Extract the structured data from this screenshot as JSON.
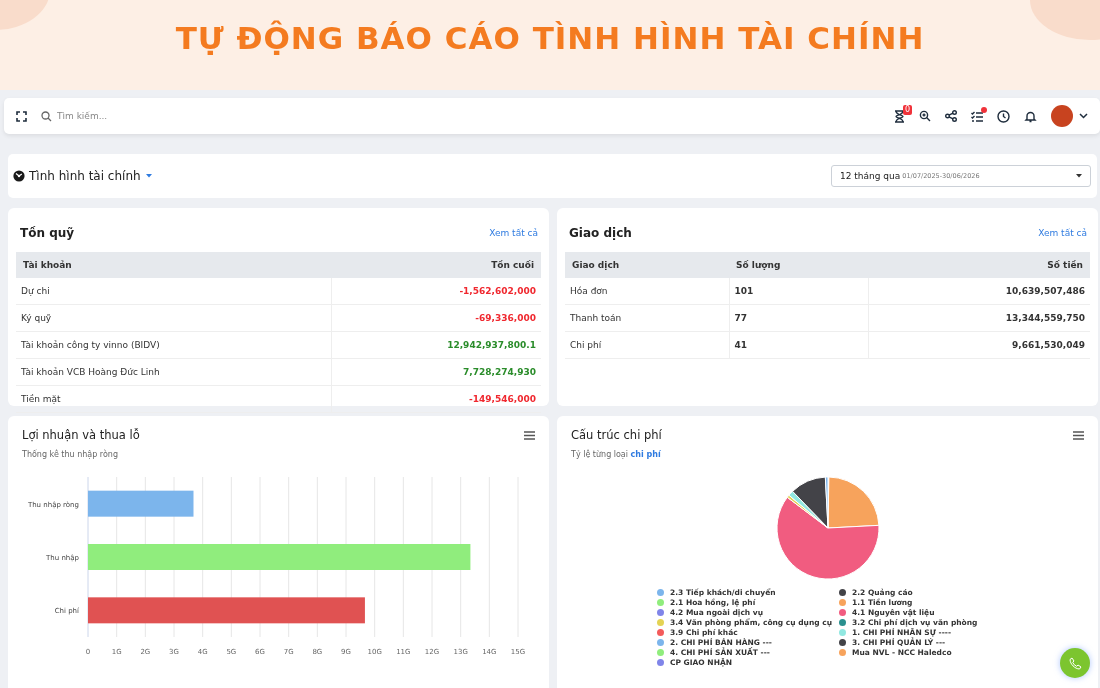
{
  "banner": {
    "title": "TỰ ĐỘNG BÁO CÁO TÌNH HÌNH TÀI CHÍNH"
  },
  "topbar": {
    "search_placeholder": "Tìm kiếm...",
    "hourglass_badge": "0",
    "tasks_dot": true
  },
  "filter": {
    "title": "Tình hình tài chính",
    "period": "12 tháng qua",
    "range": "01/07/2025-30/06/2026"
  },
  "fund_balance": {
    "title": "Tồn quỹ",
    "link": "Xem tất cả",
    "columns": [
      "Tài khoản",
      "Tồn cuối"
    ],
    "rows": [
      {
        "account": "Dự chi",
        "balance": "-1,562,602,000",
        "color": "#f0282f"
      },
      {
        "account": "Ký quỹ",
        "balance": "-69,336,000",
        "color": "#f0282f"
      },
      {
        "account": "Tài khoản công ty vinno (BIDV)",
        "balance": "12,942,937,800.1",
        "color": "#2a8c2a"
      },
      {
        "account": "Tài khoản VCB Hoàng Đức Linh",
        "balance": "7,728,274,930",
        "color": "#2a8c2a"
      },
      {
        "account": "Tiền mặt",
        "balance": "-149,546,000",
        "color": "#f0282f"
      }
    ]
  },
  "transactions": {
    "title": "Giao dịch",
    "link": "Xem tất cả",
    "columns": [
      "Giao dịch",
      "Số lượng",
      "Số tiền"
    ],
    "rows": [
      {
        "type": "Hóa đơn",
        "count": "101",
        "amount": "10,639,507,486"
      },
      {
        "type": "Thanh toán",
        "count": "77",
        "amount": "13,344,559,750"
      },
      {
        "type": "Chi phí",
        "count": "41",
        "amount": "9,661,530,049"
      }
    ]
  },
  "profit_loss": {
    "title": "Lợi nhuận và thua lỗ",
    "subtitle": "Thống kê thu nhập ròng",
    "chart_data": {
      "type": "bar",
      "orientation": "horizontal",
      "categories": [
        "Thu nhập ròng",
        "Thu nhập",
        "Chi phí"
      ],
      "values": [
        3.68,
        13.34,
        9.66
      ],
      "grid": true,
      "colors": [
        "#7cb5ec",
        "#90ed7d",
        "#e05252"
      ],
      "xlim": [
        0,
        15
      ],
      "xticks": [
        {
          "value": 0,
          "label": "0"
        },
        {
          "value": 1,
          "label": "1G"
        },
        {
          "value": 2,
          "label": "2G"
        },
        {
          "value": 3,
          "label": "3G"
        },
        {
          "value": 4,
          "label": "4G"
        },
        {
          "value": 5,
          "label": "5G"
        },
        {
          "value": 6,
          "label": "6G"
        },
        {
          "value": 7,
          "label": "7G"
        },
        {
          "value": 8,
          "label": "8G"
        },
        {
          "value": 9,
          "label": "9G"
        },
        {
          "value": 10,
          "label": "10G"
        },
        {
          "value": 11,
          "label": "11G"
        },
        {
          "value": 12,
          "label": "12G"
        },
        {
          "value": 13,
          "label": "13G"
        },
        {
          "value": 14,
          "label": "14G"
        },
        {
          "value": 15,
          "label": "15G"
        }
      ]
    }
  },
  "cost_structure": {
    "title": "Cấu trúc chi phí",
    "subtitle": "Tỷ lệ từng loại **chi phí**",
    "legend": [
      {
        "label": "2.3 Tiếp khách/di chuyển",
        "color": "#7cb5ec"
      },
      {
        "label": "2.2 Quảng cáo",
        "color": "#434348"
      },
      {
        "label": "2.1 Hoa hồng, lệ phí",
        "color": "#90ed7d"
      },
      {
        "label": "1.1 Tiền lương",
        "color": "#f7a35c"
      },
      {
        "label": "4.2 Mua ngoài dịch vụ",
        "color": "#8085e9"
      },
      {
        "label": "4.1 Nguyên vật liệu",
        "color": "#f15c80"
      },
      {
        "label": "3.4 Văn phòng phẩm, công cụ dụng cụ",
        "color": "#e4d354"
      },
      {
        "label": "3.2 Chi phí dịch vụ văn phòng",
        "color": "#2b908f"
      },
      {
        "label": "3.9 Chi phí khác",
        "color": "#f45b5b"
      },
      {
        "label": "1. CHI PHÍ NHÂN SỰ ----",
        "color": "#91e8e1"
      },
      {
        "label": "2. CHI PHÍ BÁN HÀNG ---",
        "color": "#7cb5ec"
      },
      {
        "label": "3. CHI PHÍ QUẢN LÝ ---",
        "color": "#434348"
      },
      {
        "label": "4. CHI PHÍ SẢN XUẤT ---",
        "color": "#90ed7d"
      },
      {
        "label": "Mua NVL - NCC Haledco",
        "color": "#f7a35c"
      },
      {
        "label": "CP GIAO NHẬN",
        "color": "#8085e9"
      }
    ]
  }
}
